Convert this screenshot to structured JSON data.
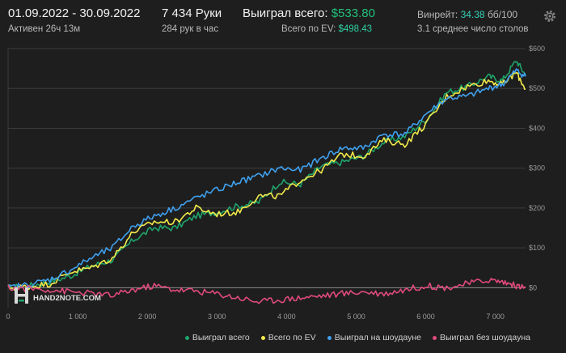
{
  "header": {
    "date_range": "01.09.2022 - 30.09.2022",
    "active_time": "Активен 26ч 13м",
    "hands": "7 434 Руки",
    "hands_per_hour": "284 рук в час",
    "won_total_label": "Выиграл всего:",
    "won_total_value": "$533.80",
    "ev_label": "Всего по EV:",
    "ev_value": "$498.43",
    "winrate_label": "Винрейт:",
    "winrate_value": "34.38",
    "winrate_unit": "бб/100",
    "avg_tables": "3.1 среднее число столов"
  },
  "logo_text": "HAND2NOTE.COM",
  "colors": {
    "won": "#1fa36b",
    "ev": "#f2ea4a",
    "showdown": "#3fa0ee",
    "non_showdown": "#e04a7a"
  },
  "legend": {
    "won": "Выиграл всего",
    "ev": "Всего по EV",
    "showdown": "Выиграл на шоудауне",
    "non_showdown": "Выиграл без шоудауна"
  },
  "chart_data": {
    "type": "line",
    "x_ticks": [
      "0",
      "1 000",
      "2 000",
      "3 000",
      "4 000",
      "5 000",
      "6 000",
      "7 000"
    ],
    "y_ticks": [
      "$600",
      "$500",
      "$400",
      "$300",
      "$200",
      "$100",
      "$0"
    ],
    "xlim": [
      0,
      7434
    ],
    "ylim": [
      -50,
      600
    ],
    "grid": true,
    "legend_position": "bottom-right",
    "x": [
      0,
      300,
      600,
      900,
      1200,
      1500,
      1800,
      2100,
      2400,
      2700,
      3000,
      3300,
      3600,
      3900,
      4200,
      4500,
      4800,
      5100,
      5400,
      5700,
      6000,
      6300,
      6600,
      6900,
      7100,
      7300,
      7434
    ],
    "series": [
      {
        "name": "Выиграл всего",
        "color_key": "won",
        "values": [
          0,
          5,
          15,
          30,
          55,
          70,
          120,
          150,
          150,
          180,
          190,
          205,
          215,
          265,
          260,
          305,
          315,
          330,
          365,
          380,
          420,
          490,
          505,
          530,
          520,
          570,
          533.8
        ]
      },
      {
        "name": "Всего по EV",
        "color_key": "ev",
        "values": [
          0,
          3,
          10,
          40,
          50,
          75,
          140,
          165,
          165,
          200,
          185,
          190,
          230,
          230,
          270,
          295,
          335,
          330,
          370,
          360,
          410,
          480,
          505,
          520,
          510,
          540,
          498.43
        ]
      },
      {
        "name": "Выиграл на шоудауне",
        "color_key": "showdown",
        "values": [
          0,
          8,
          20,
          45,
          75,
          100,
          155,
          180,
          200,
          225,
          245,
          265,
          280,
          300,
          295,
          325,
          350,
          350,
          385,
          385,
          435,
          475,
          480,
          500,
          510,
          545,
          530
        ]
      },
      {
        "name": "Выиграл без шоудауна",
        "color_key": "non_showdown",
        "values": [
          0,
          -2,
          -5,
          -10,
          -15,
          -20,
          -5,
          5,
          -5,
          -8,
          -15,
          -25,
          -35,
          -30,
          -25,
          -20,
          -15,
          -10,
          -15,
          -5,
          5,
          0,
          10,
          20,
          15,
          5,
          0
        ]
      }
    ]
  }
}
